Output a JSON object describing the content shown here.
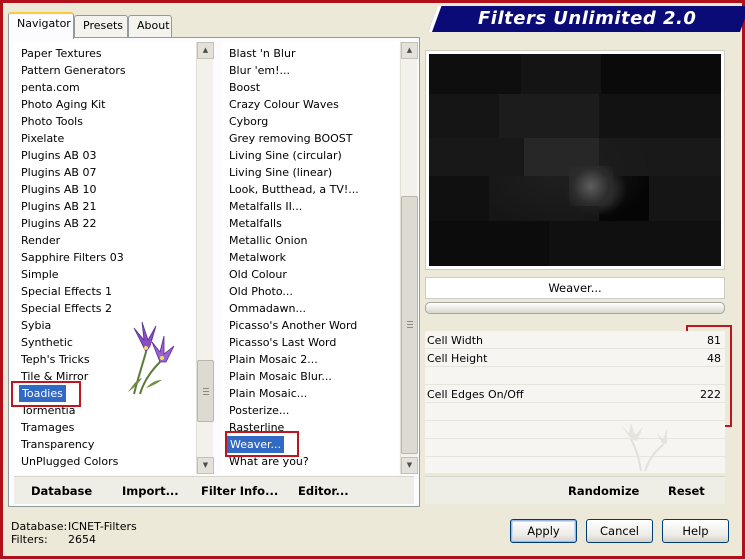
{
  "title": "Filters Unlimited 2.0",
  "tabs": [
    {
      "label": "Navigator",
      "active": true
    },
    {
      "label": "Presets",
      "active": false
    },
    {
      "label": "About",
      "active": false
    }
  ],
  "categories": [
    "Paper Textures",
    "Pattern Generators",
    "penta.com",
    "Photo Aging Kit",
    "Photo Tools",
    "Pixelate",
    "Plugins AB 03",
    "Plugins AB 07",
    "Plugins AB 10",
    "Plugins AB 21",
    "Plugins AB 22",
    "Render",
    "Sapphire Filters 03",
    "Simple",
    "Special Effects 1",
    "Special Effects 2",
    "Sybia",
    "Synthetic",
    "Teph's Tricks",
    "Tile & Mirror",
    "Toadies",
    "Tormentia",
    "Tramages",
    "Transparency",
    "UnPlugged Colors"
  ],
  "selected_category": "Toadies",
  "filters": [
    "Blast 'n Blur",
    "Blur 'em!...",
    "Boost",
    "Crazy Colour Waves",
    "Cyborg",
    "Grey removing BOOST",
    "Living Sine (circular)",
    "Living Sine (linear)",
    "Look, Butthead, a TV!...",
    "Metalfalls II...",
    "Metalfalls",
    "Metallic Onion",
    "Metalwork",
    "Old Colour",
    "Old Photo...",
    "Ommadawn...",
    "Picasso's Another Word",
    "Picasso's Last Word",
    "Plain Mosaic 2...",
    "Plain Mosaic Blur...",
    "Plain Mosaic...",
    "Posterize...",
    "Rasterline",
    "Weaver...",
    "What are you?"
  ],
  "selected_filter": "Weaver...",
  "nav_buttons": {
    "database": "Database",
    "import": "Import...",
    "filter_info": "Filter Info...",
    "editor": "Editor..."
  },
  "current_filter_name": "Weaver...",
  "params": [
    {
      "label": "Cell Width",
      "value": "81"
    },
    {
      "label": "Cell Height",
      "value": "48"
    },
    {
      "label": "Cell Edges On/Off",
      "value": "222"
    }
  ],
  "param_buttons": {
    "randomize": "Randomize",
    "reset": "Reset"
  },
  "footer": {
    "database_label": "Database:",
    "database_value": "ICNET-Filters",
    "filters_label": "Filters:",
    "filters_value": "2654"
  },
  "dialog_buttons": {
    "apply": "Apply",
    "cancel": "Cancel",
    "help": "Help"
  },
  "colors": {
    "selection": "#316ac5",
    "highlight_box": "#c0141e",
    "banner": "#0b0b78"
  },
  "icons": [
    "flower-decoration-icon",
    "flower-watermark-icon"
  ]
}
